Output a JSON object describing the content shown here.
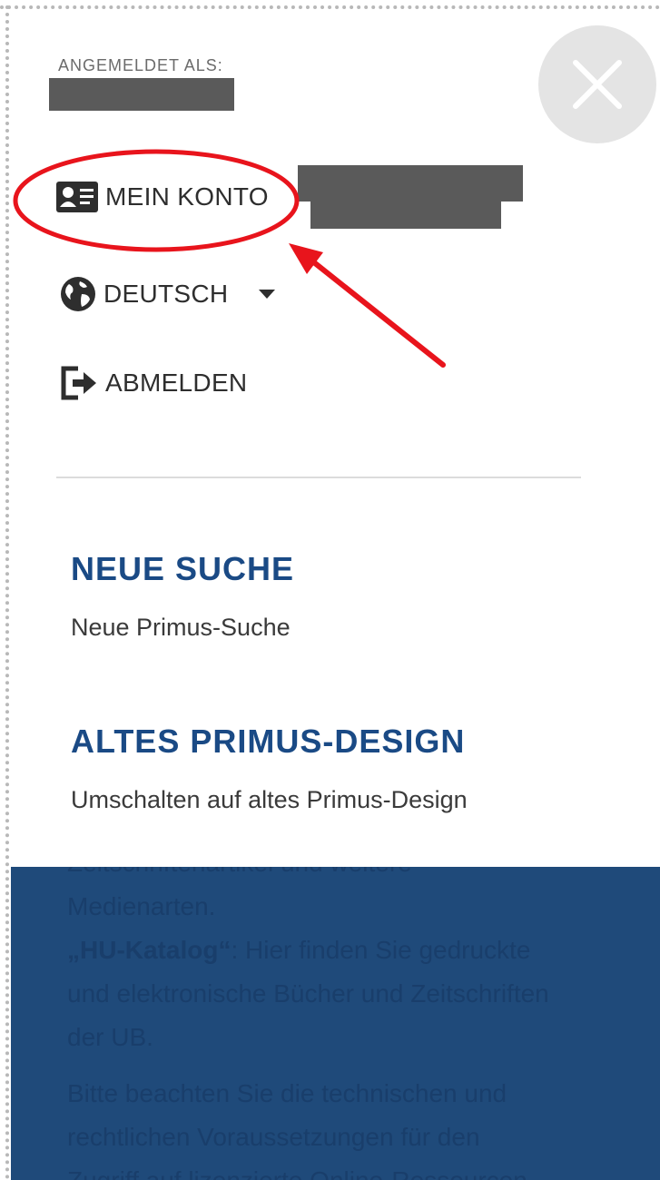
{
  "menu": {
    "logged_in_label": "ANGEMELDET ALS:",
    "items": [
      {
        "label": "MEIN KONTO",
        "icon": "id-card-icon"
      },
      {
        "label": "DEUTSCH",
        "icon": "globe-icon"
      },
      {
        "label": "ABMELDEN",
        "icon": "sign-out-icon"
      }
    ],
    "close_icon": "close-icon"
  },
  "links": [
    {
      "title": "NEUE SUCHE",
      "description": "Neue Primus-Suche"
    },
    {
      "title": "ALTES PRIMUS-DESIGN",
      "description": "Umschalten auf altes Primus-Design"
    }
  ],
  "background": {
    "line1": "Zeitschriftenartikel und weitere",
    "line2": "Medienarten.",
    "hu_label": "„HU-Katalog“",
    "hu_text": ": Hier finden Sie gedruckte",
    "line4": "und elektronische Bücher und Zeitschriften",
    "line5": "der UB.",
    "line6": "Bitte beachten Sie die technischen und",
    "line7": "rechtlichen Voraussetzungen für den",
    "line8": "Zugriff auf lizenzierte Online-Ressourcen"
  },
  "colors": {
    "accent": "#1a4a85",
    "annotation": "#e8141c",
    "background_panel": "#1f4a7a"
  }
}
